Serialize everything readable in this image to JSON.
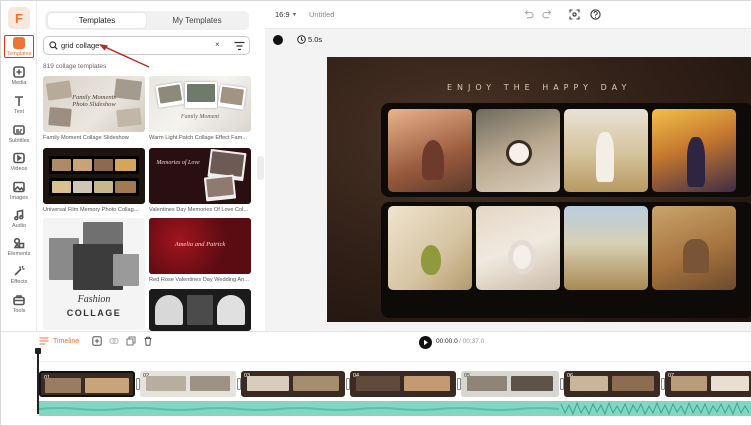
{
  "app": {
    "logo_letter": "F",
    "accent": "#ee7434"
  },
  "rail": {
    "items": [
      {
        "label": "Templates",
        "icon": "templates-icon"
      },
      {
        "label": "Media",
        "icon": "media-icon"
      },
      {
        "label": "Text",
        "icon": "text-icon"
      },
      {
        "label": "Subtitles",
        "icon": "subtitles-icon"
      },
      {
        "label": "Videos",
        "icon": "videos-icon"
      },
      {
        "label": "Images",
        "icon": "images-icon"
      },
      {
        "label": "Audio",
        "icon": "audio-icon"
      },
      {
        "label": "Elements",
        "icon": "elements-icon"
      },
      {
        "label": "Effects",
        "icon": "effects-icon"
      },
      {
        "label": "Tools",
        "icon": "tools-icon"
      }
    ]
  },
  "panel": {
    "tabs": [
      "Templates",
      "My Templates"
    ],
    "search_value": "grid collage",
    "clear_glyph": "×",
    "count_text": "819 collage templates",
    "cards": [
      {
        "caption": "Family Moment Collage Slideshow",
        "thumb_title": "Family Moments Photo Slideshow"
      },
      {
        "caption": "Warm Light Patch Collage Effect Fam...",
        "thumb_title": "Family Moment"
      },
      {
        "caption": "Universal Film Memory Photo Collag..."
      },
      {
        "caption": "Valentines Day Memories Of Love Col...",
        "thumb_title": "Memories of Love"
      },
      {
        "caption": "",
        "thumb_title": "Fashion",
        "thumb_subtitle": "COLLAGE"
      },
      {
        "caption": "Red Rose Valentines Day Wedding An...",
        "thumb_title": "Amelia and Patrick"
      },
      {
        "caption": ""
      }
    ]
  },
  "toolbar": {
    "ratio": "16:9",
    "title": "Untitled"
  },
  "stage": {
    "duration": "5.0s",
    "canvas_headline": "ENJOY THE HAPPY DAY"
  },
  "timeline": {
    "label": "Timeline",
    "current_time": "00:00.0",
    "total_time": "/ 00:37.0",
    "clip_numbers": [
      "01",
      "02",
      "03",
      "04",
      "05",
      "06",
      "07"
    ]
  }
}
